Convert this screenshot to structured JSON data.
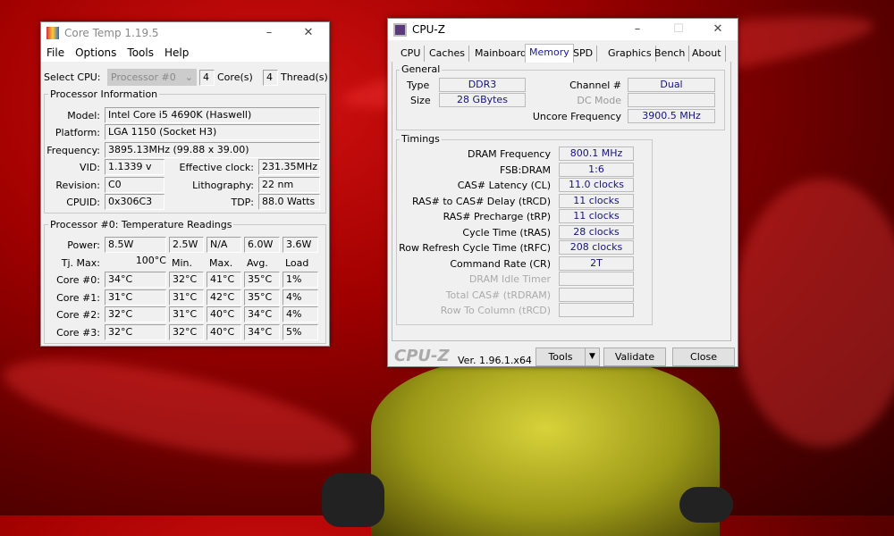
{
  "coretemp": {
    "title": "Core Temp 1.19.5",
    "menu": [
      "File",
      "Options",
      "Tools",
      "Help"
    ],
    "select_cpu_label": "Select CPU:",
    "processor_select": "Processor #0",
    "cores_count": "4",
    "cores_label": "Core(s)",
    "threads_count": "4",
    "threads_label": "Thread(s)",
    "info_group": "Processor Information",
    "model_label": "Model:",
    "model": "Intel Core i5 4690K (Haswell)",
    "platform_label": "Platform:",
    "platform": "LGA 1150 (Socket H3)",
    "frequency_label": "Frequency:",
    "frequency": "3895.13MHz (99.88 x 39.00)",
    "vid_label": "VID:",
    "vid": "1.1339 v",
    "eff_label": "Effective clock:",
    "eff": "231.35MHz",
    "revision_label": "Revision:",
    "revision": "C0",
    "litho_label": "Lithography:",
    "litho": "22 nm",
    "cpuid_label": "CPUID:",
    "cpuid": "0x306C3",
    "tdp_label": "TDP:",
    "tdp": "88.0 Watts",
    "temp_group": "Processor #0: Temperature Readings",
    "rows": [
      {
        "label": "Power:",
        "cells": [
          "8.5W",
          "2.5W",
          "N/A",
          "6.0W",
          "3.6W"
        ],
        "boxed": true
      },
      {
        "label": "Tj. Max:",
        "cells": [
          "100°C",
          "Min.",
          "Max.",
          "Avg.",
          "Load"
        ],
        "boxed": false
      },
      {
        "label": "Core #0:",
        "cells": [
          "34°C",
          "32°C",
          "41°C",
          "35°C",
          "1%"
        ],
        "boxed": true
      },
      {
        "label": "Core #1:",
        "cells": [
          "31°C",
          "31°C",
          "42°C",
          "35°C",
          "4%"
        ],
        "boxed": true
      },
      {
        "label": "Core #2:",
        "cells": [
          "32°C",
          "31°C",
          "40°C",
          "34°C",
          "4%"
        ],
        "boxed": true
      },
      {
        "label": "Core #3:",
        "cells": [
          "32°C",
          "32°C",
          "40°C",
          "34°C",
          "5%"
        ],
        "boxed": true
      }
    ]
  },
  "cpuz": {
    "title": "CPU-Z",
    "tabs": [
      "CPU",
      "Caches",
      "Mainboard",
      "Memory",
      "SPD",
      "Graphics",
      "Bench",
      "About"
    ],
    "active_tab": "Memory",
    "general_group": "General",
    "type_label": "Type",
    "type": "DDR3",
    "size_label": "Size",
    "size": "28 GBytes",
    "channel_label": "Channel #",
    "channel": "Dual",
    "dc_label": "DC Mode",
    "dc": "",
    "uncore_label": "Uncore Frequency",
    "uncore": "3900.5 MHz",
    "timings_group": "Timings",
    "timings": [
      {
        "label": "DRAM Frequency",
        "value": "800.1 MHz",
        "enabled": true
      },
      {
        "label": "FSB:DRAM",
        "value": "1:6",
        "enabled": true
      },
      {
        "label": "CAS# Latency (CL)",
        "value": "11.0 clocks",
        "enabled": true
      },
      {
        "label": "RAS# to CAS# Delay (tRCD)",
        "value": "11 clocks",
        "enabled": true
      },
      {
        "label": "RAS# Precharge (tRP)",
        "value": "11 clocks",
        "enabled": true
      },
      {
        "label": "Cycle Time (tRAS)",
        "value": "28 clocks",
        "enabled": true
      },
      {
        "label": "Row Refresh Cycle Time (tRFC)",
        "value": "208 clocks",
        "enabled": true
      },
      {
        "label": "Command Rate (CR)",
        "value": "2T",
        "enabled": true
      },
      {
        "label": "DRAM Idle Timer",
        "value": "",
        "enabled": false
      },
      {
        "label": "Total CAS# (tRDRAM)",
        "value": "",
        "enabled": false
      },
      {
        "label": "Row To Column (tRCD)",
        "value": "",
        "enabled": false
      }
    ],
    "brand": "CPU-Z",
    "version": "Ver. 1.96.1.x64",
    "tools_btn": "Tools",
    "validate_btn": "Validate",
    "close_btn": "Close"
  }
}
